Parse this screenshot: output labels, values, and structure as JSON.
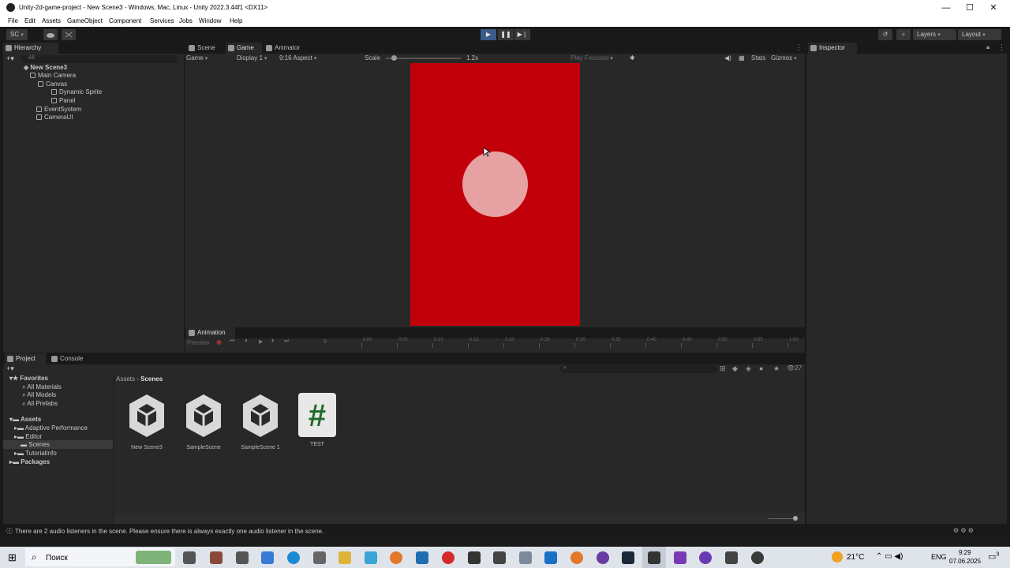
{
  "window": {
    "title": "Unity-2d-game-project - New Scene3 - Windows, Mac, Linux - Unity 2022.3.44f1 <DX11>",
    "controls": [
      "—",
      "☐",
      "✕"
    ]
  },
  "menu": [
    "File",
    "Edit",
    "Assets",
    "GameObject",
    "Component",
    "Services",
    "Jobs",
    "Window",
    "Help"
  ],
  "toolbar": {
    "account": "SC",
    "layers": "Layers",
    "layout": "Layout"
  },
  "hierarchy": {
    "tab": "Hierarchy",
    "search_placeholder": "All",
    "scene": "New Scene3",
    "items": [
      {
        "label": "Main Camera"
      },
      {
        "label": "Canvas"
      },
      {
        "label": "Dynamic Sprite"
      },
      {
        "label": "Panel"
      },
      {
        "label": "EventSystem"
      },
      {
        "label": "CameraUI"
      }
    ]
  },
  "center_tabs": [
    "Scene",
    "Game",
    "Animator"
  ],
  "game_bar": {
    "mode": "Game",
    "display": "Display 1",
    "aspect": "9:16 Aspect",
    "scale_label": "Scale",
    "scale_value": "1.2x",
    "play_focused": "Play Focused",
    "stats": "Stats",
    "gizmos": "Gizmos"
  },
  "game_view": {
    "background": "#c1000a",
    "circle_color": "#e6a1a3"
  },
  "animation": {
    "tab": "Animation",
    "preview": "Preview",
    "frame": "0",
    "ticks": [
      "0:00",
      "0:05",
      "0:10",
      "0:15",
      "0:20",
      "0:25",
      "0:30",
      "0:35",
      "0:40",
      "0:45",
      "0:50",
      "0:55",
      "1:00"
    ]
  },
  "inspector": {
    "tab": "Inspector"
  },
  "project": {
    "tabs": [
      "Project",
      "Console"
    ],
    "count": "27",
    "favorites": {
      "label": "Favorites",
      "items": [
        "All Materials",
        "All Models",
        "All Prefabs"
      ]
    },
    "assets": {
      "label": "Assets",
      "items": [
        "Adaptive Performance",
        "Editor",
        "Scenes",
        "TutorialInfo"
      ]
    },
    "packages": "Packages",
    "breadcrumb": [
      "Assets",
      "Scenes"
    ],
    "files": [
      {
        "name": "New Scene3",
        "kind": "scene"
      },
      {
        "name": "SampleScene",
        "kind": "scene"
      },
      {
        "name": "SampleScene 1",
        "kind": "scene"
      },
      {
        "name": "TEST",
        "kind": "script"
      }
    ]
  },
  "status": {
    "message": "There are 2 audio listeners in the scene. Please ensure there is always exactly one audio listener in the scene."
  },
  "taskbar": {
    "search": "Поиск",
    "weather": "21°C",
    "lang": "ENG",
    "time": "9:29",
    "date": "07.06.2025",
    "notifications": "3"
  },
  "colors": {
    "accent": "#4d8bd6",
    "editor_bg": "#282828",
    "taskbar_bg": "#dfe3ea"
  }
}
